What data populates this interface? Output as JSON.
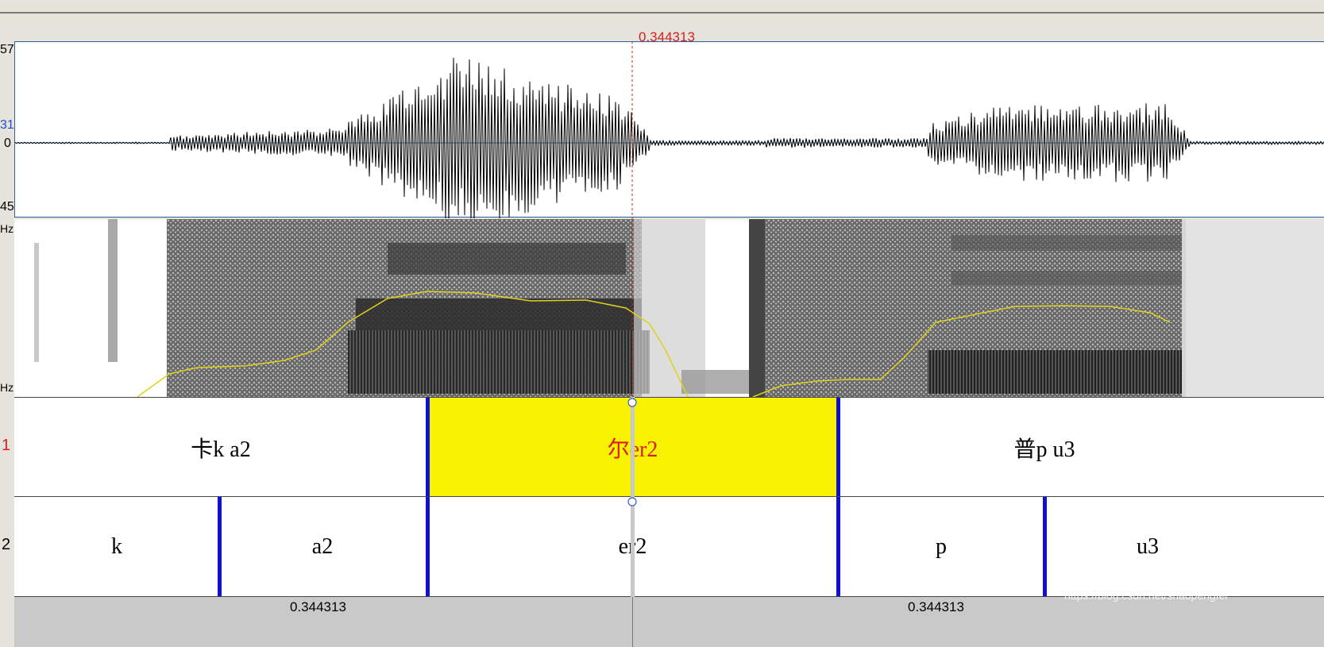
{
  "cursor": {
    "time_label": "0.344313"
  },
  "waveform": {
    "y_labels": [
      "57",
      "31",
      "0",
      "45"
    ],
    "color": "#000000"
  },
  "spectrogram": {
    "y_labels": [
      "Hz",
      "Hz"
    ],
    "pitch_color": "#e0d21a"
  },
  "tiers": [
    {
      "number": "1",
      "number_color": "#d81e1e",
      "intervals": [
        {
          "label": "卡k a2",
          "selected": false
        },
        {
          "label": "尔er2",
          "selected": true
        },
        {
          "label": "普p u3",
          "selected": false
        }
      ]
    },
    {
      "number": "2",
      "number_color": "#000000",
      "intervals": [
        {
          "label": "k"
        },
        {
          "label": "a2"
        },
        {
          "label": "er2"
        },
        {
          "label": "p"
        },
        {
          "label": "u3"
        }
      ]
    }
  ],
  "bottom_bar": {
    "left_time": "0.344313",
    "right_time": "0.344313"
  },
  "watermark": "https://blog.csdn.net/shaopengfei",
  "colors": {
    "selection": "#f7f200",
    "boundary": "#1010d0",
    "cursor": "#d81e1e"
  }
}
